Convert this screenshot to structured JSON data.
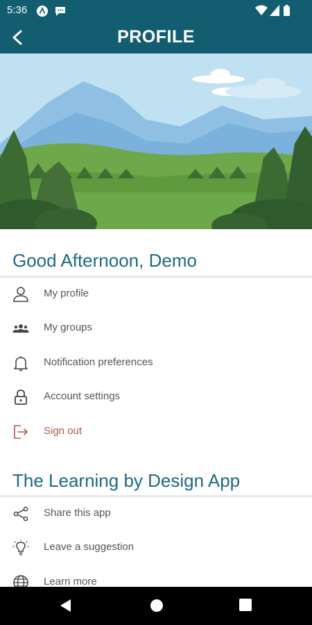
{
  "status_bar": {
    "time": "5:36"
  },
  "app_bar": {
    "title": "PROFILE"
  },
  "greeting": "Good Afternoon, Demo",
  "account_items": [
    {
      "label": "My profile",
      "icon": "person-icon"
    },
    {
      "label": "My groups",
      "icon": "groups-icon"
    },
    {
      "label": "Notification preferences",
      "icon": "bell-icon"
    },
    {
      "label": "Account settings",
      "icon": "lock-icon"
    },
    {
      "label": "Sign out",
      "icon": "sign-out-icon"
    }
  ],
  "app_section_title": "The Learning by Design App",
  "app_items": [
    {
      "label": "Share this app",
      "icon": "share-icon"
    },
    {
      "label": "Leave a suggestion",
      "icon": "lightbulb-icon"
    },
    {
      "label": "Learn more",
      "icon": "globe-icon"
    }
  ],
  "colors": {
    "primary": "#125e70",
    "section_title": "#1d6a80",
    "danger": "#b35450"
  }
}
